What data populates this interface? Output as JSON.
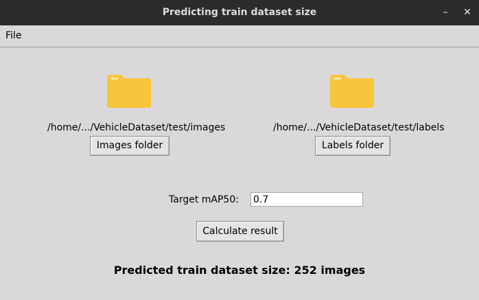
{
  "window": {
    "title": "Predicting train dataset size",
    "minimize_glyph": "–",
    "close_glyph": "✕"
  },
  "menu": {
    "items": [
      {
        "label": "File"
      }
    ]
  },
  "images": {
    "icon": "folder-icon",
    "path": "/home/.../VehicleDataset/test/images",
    "button_label": "Images folder"
  },
  "labels": {
    "icon": "folder-icon",
    "path": "/home/.../VehicleDataset/test/labels",
    "button_label": "Labels folder"
  },
  "target": {
    "label": "Target mAP50:",
    "value": "0.7"
  },
  "calculate": {
    "button_label": "Calculate result"
  },
  "result": {
    "text": "Predicted train dataset size: 252 images"
  },
  "colors": {
    "background": "#d9d9d9",
    "titlebar": "#2c2c2c",
    "folder": "#f8c53c"
  }
}
